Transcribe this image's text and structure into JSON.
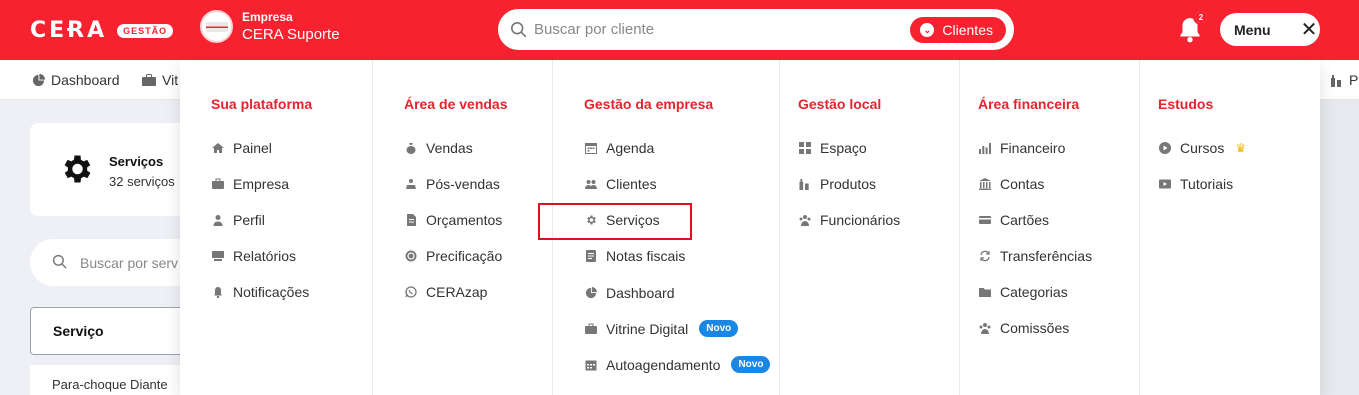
{
  "header": {
    "logo_text": "CEɌA",
    "logo_badge": "GESTÃO",
    "company_label": "Empresa",
    "company_name": "CERA Suporte",
    "search_placeholder": "Buscar por cliente",
    "search_scope": "Clientes",
    "notifications_count": "2",
    "menu_label": "Menu"
  },
  "subnav": {
    "items": [
      {
        "label": "Dashboard",
        "icon": "pie-chart-icon"
      },
      {
        "label": "Vit",
        "icon": "briefcase-icon"
      },
      {
        "label": "P",
        "icon": "bottles-icon"
      }
    ]
  },
  "page": {
    "services_title": "Serviços",
    "services_count": "32 serviços",
    "search_placeholder": "Buscar por serv",
    "column_header": "Serviço",
    "first_row": "Para-choque Diante"
  },
  "mega_menu": {
    "columns": [
      {
        "title": "Sua plataforma",
        "items": [
          {
            "label": "Painel",
            "icon": "home-icon"
          },
          {
            "label": "Empresa",
            "icon": "briefcase-icon"
          },
          {
            "label": "Perfil",
            "icon": "user-icon"
          },
          {
            "label": "Relatórios",
            "icon": "report-icon"
          },
          {
            "label": "Notificações",
            "icon": "bell-icon"
          }
        ]
      },
      {
        "title": "Área de vendas",
        "items": [
          {
            "label": "Vendas",
            "icon": "money-bag-icon"
          },
          {
            "label": "Pós-vendas",
            "icon": "after-sales-icon"
          },
          {
            "label": "Orçamentos",
            "icon": "document-icon"
          },
          {
            "label": "Precificação",
            "icon": "coin-icon"
          },
          {
            "label": "CERAzap",
            "icon": "whatsapp-icon"
          }
        ]
      },
      {
        "title": "Gestão da empresa",
        "items": [
          {
            "label": "Agenda",
            "icon": "calendar-icon"
          },
          {
            "label": "Clientes",
            "icon": "users-icon"
          },
          {
            "label": "Serviços",
            "icon": "gear-icon"
          },
          {
            "label": "Notas fiscais",
            "icon": "invoice-icon"
          },
          {
            "label": "Dashboard",
            "icon": "pie-chart-icon"
          },
          {
            "label": "Vitrine Digital",
            "icon": "briefcase-icon",
            "badge": "Novo"
          },
          {
            "label": "Autoagendamento",
            "icon": "calendar-grid-icon",
            "badge": "Novo"
          }
        ]
      },
      {
        "title": "Gestão local",
        "items": [
          {
            "label": "Espaço",
            "icon": "grid-icon"
          },
          {
            "label": "Produtos",
            "icon": "bottles-icon"
          },
          {
            "label": "Funcionários",
            "icon": "team-icon"
          }
        ]
      },
      {
        "title": "Área financeira",
        "items": [
          {
            "label": "Financeiro",
            "icon": "bar-chart-icon"
          },
          {
            "label": "Contas",
            "icon": "bank-icon"
          },
          {
            "label": "Cartões",
            "icon": "credit-card-icon"
          },
          {
            "label": "Transferências",
            "icon": "transfer-icon"
          },
          {
            "label": "Categorias",
            "icon": "folder-icon"
          },
          {
            "label": "Comissões",
            "icon": "team-icon"
          }
        ]
      },
      {
        "title": "Estudos",
        "items": [
          {
            "label": "Cursos",
            "icon": "play-circle-icon",
            "crown": true
          },
          {
            "label": "Tutoriais",
            "icon": "video-icon"
          }
        ]
      }
    ]
  },
  "colors": {
    "brand": "#f6222f",
    "heading": "#e8232e",
    "badge_new": "#1b87e5"
  }
}
